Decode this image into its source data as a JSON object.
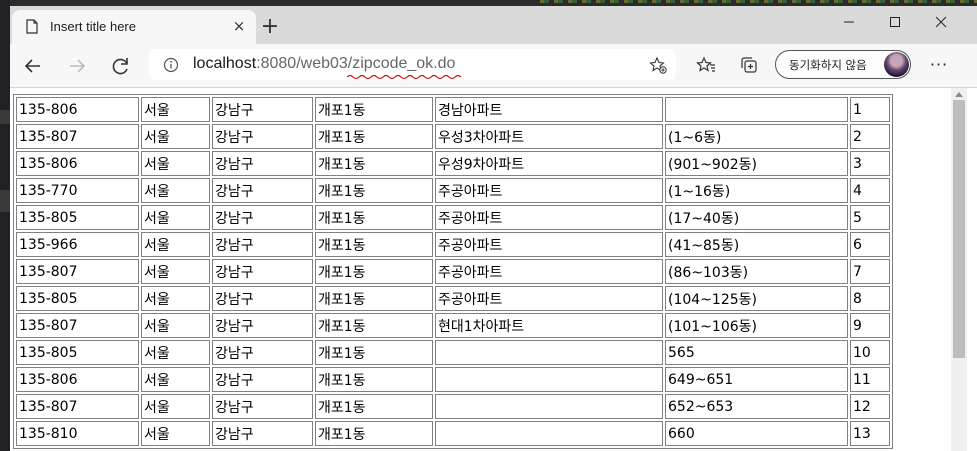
{
  "browser": {
    "tab_title": "Insert title here",
    "new_tab_glyph": "+",
    "close_tab_glyph": "×",
    "url_host": "localhost",
    "url_path": ":8080/web03/zipcode_ok.do",
    "sync_label": "동기화하지 않음",
    "more_glyph": "···",
    "icons": [
      "page-icon",
      "close-icon",
      "plus-icon",
      "minimize-icon",
      "maximize-icon",
      "window-close-icon",
      "back-arrow-icon",
      "forward-arrow-icon",
      "reload-icon",
      "info-icon",
      "add-favorite-icon",
      "favorites-icon",
      "collections-icon",
      "avatar",
      "more-icon"
    ]
  },
  "table": {
    "rows": [
      [
        "135-806",
        "서울",
        "강남구",
        "개포1동",
        "경남아파트",
        "",
        "1"
      ],
      [
        "135-807",
        "서울",
        "강남구",
        "개포1동",
        "우성3차아파트",
        "(1~6동)",
        "2"
      ],
      [
        "135-806",
        "서울",
        "강남구",
        "개포1동",
        "우성9차아파트",
        "(901~902동)",
        "3"
      ],
      [
        "135-770",
        "서울",
        "강남구",
        "개포1동",
        "주공아파트",
        "(1~16동)",
        "4"
      ],
      [
        "135-805",
        "서울",
        "강남구",
        "개포1동",
        "주공아파트",
        "(17~40동)",
        "5"
      ],
      [
        "135-966",
        "서울",
        "강남구",
        "개포1동",
        "주공아파트",
        "(41~85동)",
        "6"
      ],
      [
        "135-807",
        "서울",
        "강남구",
        "개포1동",
        "주공아파트",
        "(86~103동)",
        "7"
      ],
      [
        "135-805",
        "서울",
        "강남구",
        "개포1동",
        "주공아파트",
        "(104~125동)",
        "8"
      ],
      [
        "135-807",
        "서울",
        "강남구",
        "개포1동",
        "현대1차아파트",
        "(101~106동)",
        "9"
      ],
      [
        "135-805",
        "서울",
        "강남구",
        "개포1동",
        "",
        "565",
        "10"
      ],
      [
        "135-806",
        "서울",
        "강남구",
        "개포1동",
        "",
        "649~651",
        "11"
      ],
      [
        "135-807",
        "서울",
        "강남구",
        "개포1동",
        "",
        "652~653",
        "12"
      ],
      [
        "135-810",
        "서울",
        "강남구",
        "개포1동",
        "",
        "660",
        "13"
      ]
    ]
  }
}
